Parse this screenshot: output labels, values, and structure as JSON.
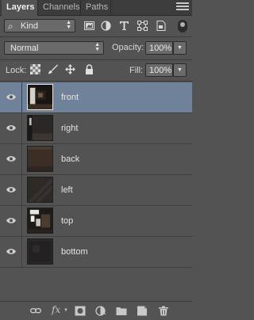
{
  "tabs": [
    {
      "label": "Layers",
      "active": true
    },
    {
      "label": "Channels",
      "active": false
    },
    {
      "label": "Paths",
      "active": false
    }
  ],
  "filter": {
    "kind_label": "Kind",
    "icons": [
      "pixel-layer-filter-icon",
      "adjustment-layer-filter-icon",
      "type-layer-filter-icon",
      "shape-layer-filter-icon",
      "smart-object-filter-icon"
    ]
  },
  "blend": {
    "mode": "Normal",
    "opacity_label": "Opacity:",
    "opacity_value": "100%"
  },
  "lock": {
    "label": "Lock:",
    "icons": [
      "lock-transparent-pixels-icon",
      "lock-image-pixels-icon",
      "lock-position-icon",
      "lock-all-icon"
    ],
    "fill_label": "Fill:",
    "fill_value": "100%"
  },
  "layers": [
    {
      "name": "front",
      "selected": true
    },
    {
      "name": "right",
      "selected": false
    },
    {
      "name": "back",
      "selected": false
    },
    {
      "name": "left",
      "selected": false
    },
    {
      "name": "top",
      "selected": false
    },
    {
      "name": "bottom",
      "selected": false
    }
  ],
  "bottom_toolbar": {
    "fx_label": "fx",
    "icons": [
      "link-layers-icon",
      "layer-style-icon",
      "add-mask-icon",
      "adjustment-layer-icon",
      "new-group-icon",
      "new-layer-icon",
      "delete-layer-icon"
    ]
  },
  "colors": {
    "panel_bg": "#535353",
    "selected_row": "#6f829a",
    "tabbar_bg": "#3c3c3c"
  }
}
